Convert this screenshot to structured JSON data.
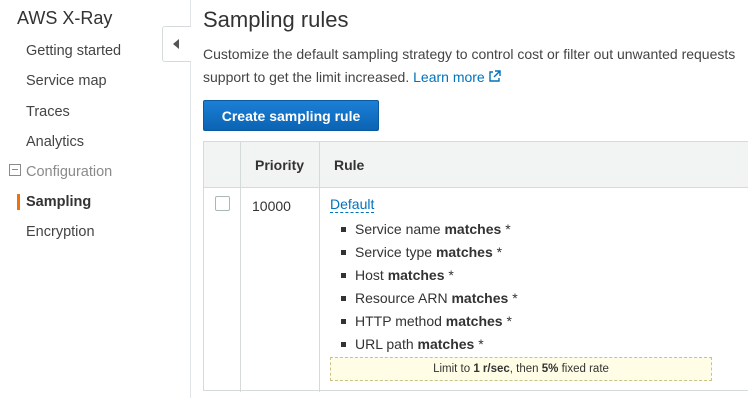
{
  "app": {
    "title": "AWS X-Ray"
  },
  "sidebar": {
    "items": [
      {
        "label": "Getting started"
      },
      {
        "label": "Service map"
      },
      {
        "label": "Traces"
      },
      {
        "label": "Analytics"
      },
      {
        "label": "Configuration"
      },
      {
        "label": "Sampling"
      },
      {
        "label": "Encryption"
      }
    ],
    "active": "Sampling",
    "accent_color": "#ec7211"
  },
  "main": {
    "title": "Sampling rules",
    "description_line1": "Customize the default sampling strategy to control cost or filter out unwanted requests",
    "description_line2": "support to get the limit increased.",
    "learn_more": "Learn more",
    "create_button": "Create sampling rule",
    "table": {
      "headers": {
        "priority": "Priority",
        "rule": "Rule"
      },
      "rows": [
        {
          "priority": "10000",
          "rule_name": "Default",
          "conditions": [
            {
              "field": "Service name",
              "op": "matches",
              "value": "*"
            },
            {
              "field": "Service type",
              "op": "matches",
              "value": "*"
            },
            {
              "field": "Host",
              "op": "matches",
              "value": "*"
            },
            {
              "field": "Resource ARN",
              "op": "matches",
              "value": "*"
            },
            {
              "field": "HTTP method",
              "op": "matches",
              "value": "*"
            },
            {
              "field": "URL path",
              "op": "matches",
              "value": "*"
            }
          ],
          "limit": {
            "prefix": "Limit to",
            "reservoir": "1 r/sec",
            "middle": ", then",
            "rate": "5%",
            "suffix": "fixed rate"
          }
        }
      ]
    }
  },
  "colors": {
    "primary_button": "#0f6fc4",
    "link": "#0073bb"
  }
}
